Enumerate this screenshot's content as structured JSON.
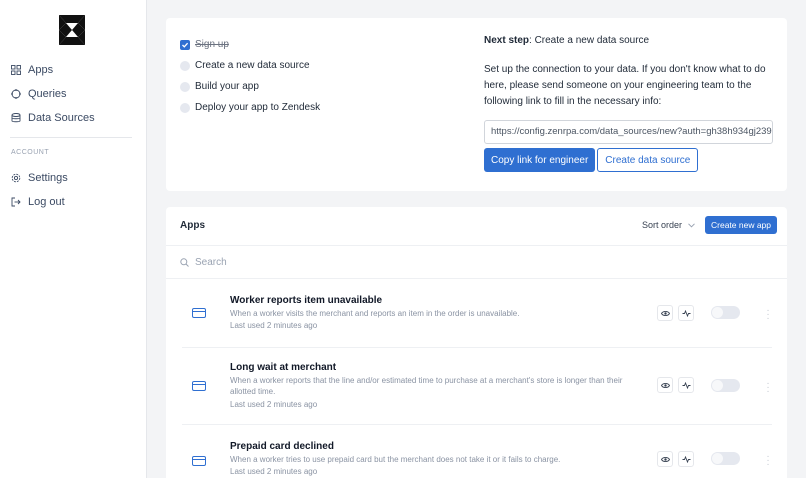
{
  "sidebar": {
    "items": [
      {
        "label": "Apps",
        "icon": "grid-icon"
      },
      {
        "label": "Queries",
        "icon": "circle-icon"
      },
      {
        "label": "Data Sources",
        "icon": "database-icon"
      }
    ],
    "section_label": "ACCOUNT",
    "account_items": [
      {
        "label": "Settings",
        "icon": "gear-icon"
      },
      {
        "label": "Log out",
        "icon": "logout-icon"
      }
    ]
  },
  "onboarding": {
    "steps": [
      {
        "label": "Sign up",
        "done": true
      },
      {
        "label": "Create a new data source",
        "done": false
      },
      {
        "label": "Build your app",
        "done": false
      },
      {
        "label": "Deploy your app to Zendesk",
        "done": false
      }
    ],
    "next_step_prefix": "Next step",
    "next_step_text": ": Create a new data source",
    "description": "Set up the connection to your data. If you don't know what to do here, please send someone on your engineering team to the following link to fill in the necessary info:",
    "link_value": "https://config.zenrpa.com/data_sources/new?auth=gh38h934gj239",
    "copy_button": "Copy link for engineer",
    "create_button": "Create data source"
  },
  "apps": {
    "title": "Apps",
    "sort_label": "Sort order",
    "new_button": "Create new app",
    "search_placeholder": "Search",
    "rows": [
      {
        "title": "Worker reports item unavailable",
        "desc": "When a worker visits the merchant and reports an item in the order is unavailable.",
        "used": "Last used 2 minutes ago",
        "enabled": false
      },
      {
        "title": "Long wait at merchant",
        "desc": "When a worker reports that the line and/or estimated time to purchase at a merchant's store is longer than their allotted time.",
        "used": "Last used 2 minutes ago",
        "enabled": false
      },
      {
        "title": "Prepaid card declined",
        "desc": "When a worker tries to use prepaid card but the merchant does not take it or it fails to charge.",
        "used": "Last used 2 minutes ago",
        "enabled": false
      }
    ]
  },
  "colors": {
    "accent": "#2f6fd1",
    "text": "#1f2937",
    "muted": "#8a93a3",
    "background": "#f3f4f6"
  }
}
